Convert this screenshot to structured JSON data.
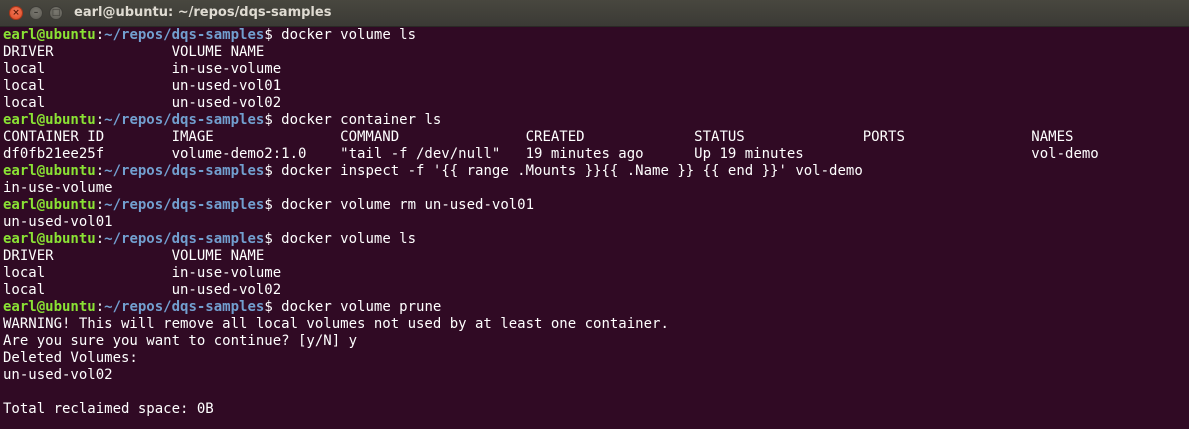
{
  "window": {
    "title": "earl@ubuntu: ~/repos/dqs-samples",
    "close_glyph": "×",
    "minimize_glyph": "–",
    "maximize_glyph": "□"
  },
  "terminal": {
    "prompt": {
      "user_host": "earl@ubuntu",
      "colon": ":",
      "path": "~/repos/dqs-samples",
      "dollar": "$ "
    },
    "lines": [
      {
        "type": "prompt",
        "command": "docker volume ls"
      },
      {
        "type": "output",
        "text": "DRIVER              VOLUME NAME"
      },
      {
        "type": "output",
        "text": "local               in-use-volume"
      },
      {
        "type": "output",
        "text": "local               un-used-vol01"
      },
      {
        "type": "output",
        "text": "local               un-used-vol02"
      },
      {
        "type": "prompt",
        "command": "docker container ls"
      },
      {
        "type": "output",
        "text": "CONTAINER ID        IMAGE               COMMAND               CREATED             STATUS              PORTS               NAMES"
      },
      {
        "type": "output",
        "text": "df0fb21ee25f        volume-demo2:1.0    \"tail -f /dev/null\"   19 minutes ago      Up 19 minutes                           vol-demo"
      },
      {
        "type": "prompt",
        "command": "docker inspect -f '{{ range .Mounts }}{{ .Name }} {{ end }}' vol-demo"
      },
      {
        "type": "output",
        "text": "in-use-volume"
      },
      {
        "type": "prompt",
        "command": "docker volume rm un-used-vol01"
      },
      {
        "type": "output",
        "text": "un-used-vol01"
      },
      {
        "type": "prompt",
        "command": "docker volume ls"
      },
      {
        "type": "output",
        "text": "DRIVER              VOLUME NAME"
      },
      {
        "type": "output",
        "text": "local               in-use-volume"
      },
      {
        "type": "output",
        "text": "local               un-used-vol02"
      },
      {
        "type": "prompt",
        "command": "docker volume prune"
      },
      {
        "type": "output",
        "text": "WARNING! This will remove all local volumes not used by at least one container."
      },
      {
        "type": "output",
        "text": "Are you sure you want to continue? [y/N] y"
      },
      {
        "type": "output",
        "text": "Deleted Volumes:"
      },
      {
        "type": "output",
        "text": "un-used-vol02"
      },
      {
        "type": "output",
        "text": ""
      },
      {
        "type": "output",
        "text": "Total reclaimed space: 0B"
      }
    ]
  },
  "colors": {
    "background": "#300a24",
    "prompt_user": "#8ae234",
    "prompt_path": "#729fcf",
    "text": "#ffffff"
  }
}
